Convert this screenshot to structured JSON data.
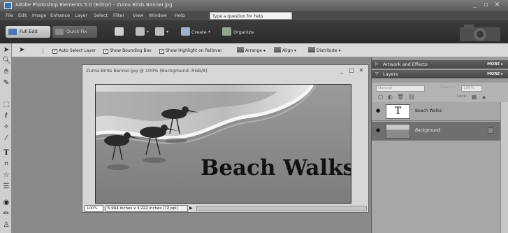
{
  "window": {
    "title": "Adobe Photoshop Elements 5.0 (Editor) - Zuma Birds Banner.jpg",
    "minimize_icon": "minimize-icon",
    "maximize_icon": "maximize-icon",
    "close_icon": "close-icon"
  },
  "menubar": {
    "items": [
      "File",
      "Edit",
      "Image",
      "Enhance",
      "Layer",
      "Select",
      "Filter",
      "View",
      "Window",
      "Help"
    ],
    "help_placeholder": "Type a question for help"
  },
  "modebar": {
    "full_edit": "Full Edit",
    "quick_fix": "Quick Fix",
    "create": "Create",
    "organize": "Organize"
  },
  "options": {
    "auto_select_layer": "Auto Select Layer",
    "show_bounding_box": "Show Bounding Box",
    "show_highlight": "Show Highlight on Rollover",
    "arrange": "Arrange",
    "align": "Align",
    "distribute": "Distribute"
  },
  "document": {
    "title": "Zuma Birds Banner.jpg @ 100% (Background, RGB/8)",
    "banner_text": "Beach Walks",
    "zoom": "100%",
    "info": "5.944 inches x 3.222 inches (72 ppi)"
  },
  "palettes": {
    "artwork_title": "Artwork and Effects",
    "layers_title": "Layers",
    "more": "MORE",
    "blend_mode": "Normal",
    "opacity_label": "Opacity:",
    "opacity_value": "100%",
    "lock_label": "Lock:",
    "layers": [
      {
        "name": "Beach Walks",
        "thumb": "T"
      },
      {
        "name": "Background"
      }
    ]
  },
  "colors": {
    "accent_selected_layer": "#6f6f6f",
    "dark_chrome": "#2b2b2b"
  }
}
